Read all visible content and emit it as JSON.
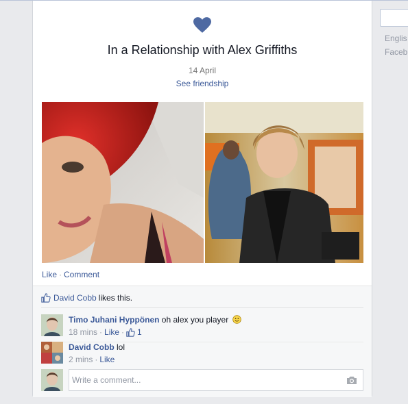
{
  "story": {
    "headline": "In a Relationship with Alex Griffiths",
    "date": "14 April",
    "see_friendship": "See friendship"
  },
  "actions": {
    "like": "Like",
    "separator": "·",
    "comment": "Comment"
  },
  "likes": {
    "name": "David Cobb",
    "suffix": "likes this."
  },
  "comments": [
    {
      "author": "Timo Juhani Hyppönen",
      "text": "oh alex you player",
      "time": "18 mins",
      "like": "Like",
      "like_count": "1"
    },
    {
      "author": "David Cobb",
      "text": "lol",
      "time": "2 mins",
      "like": "Like"
    }
  ],
  "composer": {
    "placeholder": "Write a comment..."
  },
  "sidebar": {
    "language": "Englis",
    "footer": "Faceb"
  },
  "colors": {
    "link": "#3b5998",
    "heart": "#4e69a2",
    "page_bg": "#e9eaed",
    "ufi_bg": "#f6f7f8"
  },
  "icons": [
    "heart-icon",
    "thumbs-up-icon",
    "smiley-icon",
    "camera-icon"
  ]
}
